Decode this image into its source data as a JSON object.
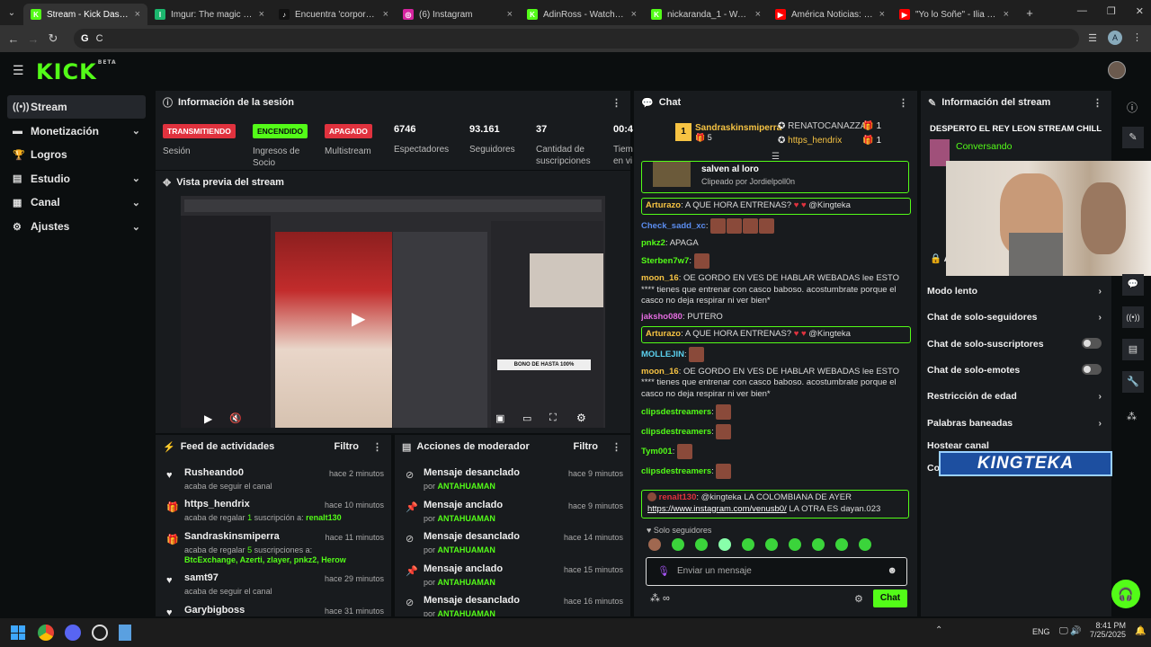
{
  "browser": {
    "tabs": [
      {
        "title": "Stream - Kick Dashboard",
        "fav": "K",
        "color": "#53fc18",
        "active": true
      },
      {
        "title": "Imgur: The magic of the Internet",
        "fav": "I",
        "color": "#1bb76e"
      },
      {
        "title": "Encuentra 'corporacion tot...",
        "fav": "♪",
        "color": "#111"
      },
      {
        "title": "(6) Instagram",
        "fav": "◎",
        "color": "#d6249f"
      },
      {
        "title": "AdinRoss - Watch clips on Kick",
        "fav": "K",
        "color": "#53fc18"
      },
      {
        "title": "nickaranda_1 - Watch clip",
        "fav": "K",
        "color": "#53fc18"
      },
      {
        "title": "América Noticias: Familia",
        "fav": "▶",
        "color": "#ff0000"
      },
      {
        "title": "\"Yo lo Soñe\" - Ilia Topuria",
        "fav": "▶",
        "color": "#ff0000"
      }
    ],
    "address": "C"
  },
  "app": {
    "logo": "KICK",
    "logo_sup": "BETA"
  },
  "sidebar": {
    "items": [
      {
        "label": "Stream",
        "icon": "((•))",
        "active": true
      },
      {
        "label": "Monetización",
        "icon": "▬",
        "chev": "⌄"
      },
      {
        "label": "Logros",
        "icon": "🏆"
      },
      {
        "label": "Estudio",
        "icon": "▤",
        "chev": "⌄"
      },
      {
        "label": "Canal",
        "icon": "▦",
        "chev": "⌄"
      },
      {
        "label": "Ajustes",
        "icon": "⚙",
        "chev": "⌄"
      }
    ]
  },
  "session": {
    "title": "Información de la sesión",
    "badges": [
      {
        "label": "TRANSMITIENDO",
        "sub": "Sesión",
        "bg": "#e0323e",
        "fg": "#fff"
      },
      {
        "label": "ENCENDIDO",
        "sub": "Ingresos de Socio",
        "bg": "#53fc18",
        "fg": "#0b0e0f"
      },
      {
        "label": "APAGADO",
        "sub": "Multistream",
        "bg": "#e0323e",
        "fg": "#fff"
      }
    ],
    "stats": [
      {
        "value": "6746",
        "label": "Espectadores"
      },
      {
        "value": "93.161",
        "label": "Seguidores"
      },
      {
        "value": "37",
        "label": "Cantidad de suscripciones"
      },
      {
        "value": "00:4",
        "label": "Tiem en vi"
      }
    ]
  },
  "preview": {
    "title": "Vista previa del stream",
    "overlay_text": "BONO DE HASTA 100%"
  },
  "feed": {
    "title": "Feed de actividades",
    "filter": "Filtro",
    "items": [
      {
        "icon": "heart",
        "name": "Rusheando0",
        "sub": "acaba de seguir el canal",
        "time": "hace 2 minutos"
      },
      {
        "icon": "gift",
        "name": "https_hendrix",
        "sub_pre": "acaba de regalar ",
        "sub_num": "1",
        "sub_post": " suscripción a: ",
        "sub_user": "renalt130",
        "time": "hace 10 minutos"
      },
      {
        "icon": "gift",
        "name": "Sandraskinsmiperra",
        "sub_pre": "acaba de regalar ",
        "sub_num": "5",
        "sub_post": " suscripciones a:",
        "sub_user": "BtcExchange, Azerti, zlayer, pnkz2, Herow",
        "time": "hace 11 minutos"
      },
      {
        "icon": "heart",
        "name": "samt97",
        "sub": "acaba de seguir el canal",
        "time": "hace 29 minutos"
      },
      {
        "icon": "heart",
        "name": "Garybigboss",
        "sub": "",
        "time": "hace 31 minutos"
      }
    ]
  },
  "modactions": {
    "title": "Acciones de moderador",
    "filter": "Filtro",
    "by": "por",
    "items": [
      {
        "action": "Mensaje desanclado",
        "user": "ANTAHUAMAN",
        "time": "hace 9 minutos",
        "icon": "unpin"
      },
      {
        "action": "Mensaje anclado",
        "user": "ANTAHUAMAN",
        "time": "hace 9 minutos",
        "icon": "pin"
      },
      {
        "action": "Mensaje desanclado",
        "user": "ANTAHUAMAN",
        "time": "hace 14 minutos",
        "icon": "unpin"
      },
      {
        "action": "Mensaje anclado",
        "user": "ANTAHUAMAN",
        "time": "hace 15 minutos",
        "icon": "pin"
      },
      {
        "action": "Mensaje desanclado",
        "user": "ANTAHUAMAN",
        "time": "hace 16 minutos",
        "icon": "unpin"
      }
    ]
  },
  "chat": {
    "title": "Chat",
    "top_gifters": [
      {
        "rank": "1",
        "name": "Sandraskinsmiperra",
        "count": "5"
      },
      {
        "name": "RENATOCANAZZA",
        "count": "1"
      },
      {
        "name": "https_hendrix",
        "count": "1"
      }
    ],
    "clip": {
      "title": "salven al loro",
      "by": "Clipeado por Jordielpoll0n"
    },
    "messages": [
      {
        "user": "Arturazo",
        "color": "#f6c343",
        "text": " A QUE HORA ENTRENAS? ",
        "mention": "@Kingteka",
        "highlight": true
      },
      {
        "user": "Check_sadd_xc",
        "color": "#5b8def",
        "text": "",
        "emotes": 4
      },
      {
        "user": "pnkz2",
        "color": "#53fc18",
        "text": " APAGA"
      },
      {
        "user": "Sterben7w7",
        "color": "#53fc18",
        "text": "",
        "emotes": 1
      },
      {
        "user": "moon_16",
        "color": "#f6c343",
        "text": " OE GORDO EN VES DE HABLAR WEBADAS lee ESTO **** tienes que entrenar con casco baboso. acostumbrate porque el casco no deja respirar ni ver bien*"
      },
      {
        "user": "jaksho080",
        "color": "#e46ce0",
        "text": " PUTERO"
      },
      {
        "user": "Arturazo",
        "color": "#f6c343",
        "text": " A QUE HORA ENTRENAS? ",
        "mention": "@Kingteka",
        "highlight": true
      },
      {
        "user": "MOLLEJIN",
        "color": "#5bd1ef",
        "text": "",
        "emotes": 1
      },
      {
        "user": "moon_16",
        "color": "#f6c343",
        "text": " OE GORDO EN VES DE HABLAR WEBADAS lee ESTO **** tienes que entrenar con casco baboso. acostumbrate porque el casco no deja respirar ni ver bien*"
      },
      {
        "user": "clipsdestreamers",
        "color": "#53fc18",
        "text": "",
        "emotes": 1
      },
      {
        "user": "clipsdestreamers",
        "color": "#53fc18",
        "text": "",
        "emotes": 1
      },
      {
        "user": "Tym001",
        "color": "#53fc18",
        "text": "",
        "emotes": 1
      },
      {
        "user": "clipsdestreamers",
        "color": "#53fc18",
        "text": "",
        "emotes": 1
      }
    ],
    "last": {
      "user": "renalt130",
      "text": " @kingteka LA COLOMBIANA DE AYER",
      "link": "https://www.instagram.com/venusb0/",
      "tail": " LA OTRA ES dayan.023"
    },
    "followers_only": "Solo seguidores",
    "input_placeholder": "Enviar un mensaje",
    "send": "Chat"
  },
  "streaminfo": {
    "title": "Información del stream",
    "stream_title": "DESPERTO EL REY LEON STREAM CHILL",
    "category": "Conversando",
    "overlay_name": "KINGTEKA",
    "settings_header": "Ac",
    "settings": [
      {
        "label": "Modo lento",
        "type": "chevron"
      },
      {
        "label": "Chat de solo-seguidores",
        "type": "chevron"
      },
      {
        "label": "Chat de solo-suscriptores",
        "type": "toggle"
      },
      {
        "label": "Chat de solo-emotes",
        "type": "toggle"
      },
      {
        "label": "Restricción de edad",
        "type": "chevron"
      },
      {
        "label": "Palabras baneadas",
        "type": "chevron"
      },
      {
        "label": "Hostear canal",
        "type": "none"
      },
      {
        "label": "Co",
        "type": "none"
      }
    ]
  },
  "taskbar": {
    "lang": "ENG",
    "time": "8:41 PM",
    "date": "7/25/2025"
  }
}
